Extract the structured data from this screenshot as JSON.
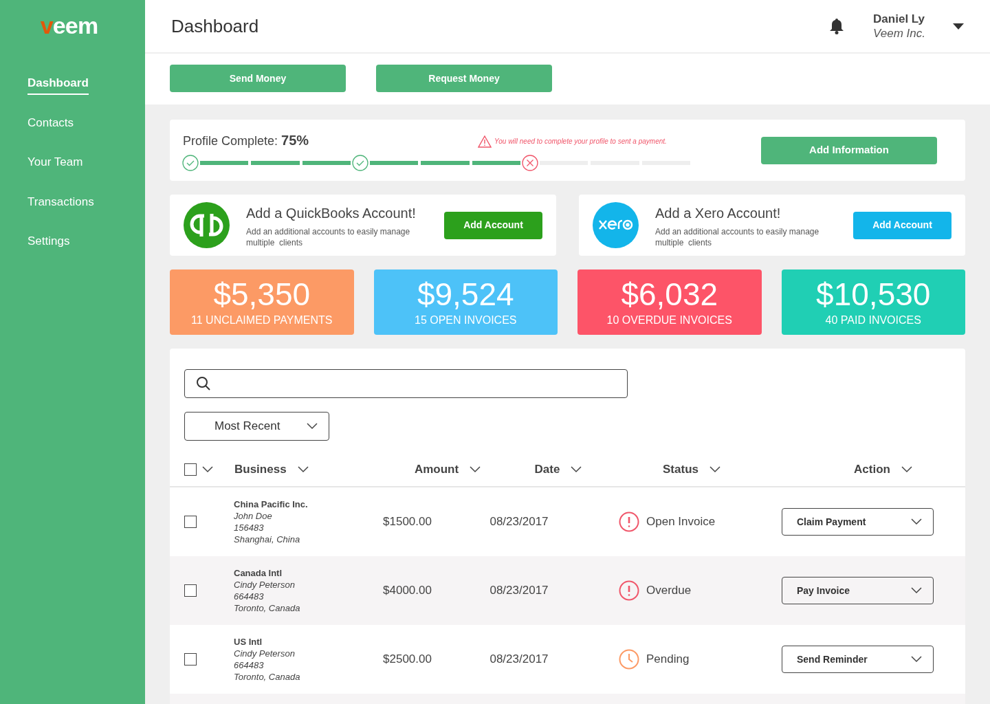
{
  "sidebar": {
    "logo": "veem",
    "items": [
      {
        "label": "Dashboard",
        "selected": true
      },
      {
        "label": "Contacts",
        "selected": false
      },
      {
        "label": "Your Team",
        "selected": false
      },
      {
        "label": "Transactions",
        "selected": false
      },
      {
        "label": "Settings",
        "selected": false
      }
    ]
  },
  "header": {
    "title": "Dashboard",
    "user_name": "Daniel Ly",
    "company": "Veem Inc."
  },
  "actions": [
    "Send Money",
    "Request Money"
  ],
  "profile": {
    "label": "Profile Complete:",
    "percent": "75%",
    "warning": "You will need to complete your profile to sent a payment.",
    "button": "Add Information",
    "steps": [
      {
        "kind": "done"
      },
      {
        "kind": "segment",
        "filled": true
      },
      {
        "kind": "segment",
        "filled": true
      },
      {
        "kind": "segment",
        "filled": true
      },
      {
        "kind": "done"
      },
      {
        "kind": "segment",
        "filled": true
      },
      {
        "kind": "segment",
        "filled": true
      },
      {
        "kind": "segment",
        "filled": true
      },
      {
        "kind": "error"
      },
      {
        "kind": "segment",
        "filled": false
      },
      {
        "kind": "segment",
        "filled": false
      },
      {
        "kind": "segment",
        "filled": false
      }
    ]
  },
  "integrations": [
    {
      "kind": "quickbooks",
      "title": "Add a QuickBooks Account!",
      "description": "Add an additional accounts to easily manage multiple  clients",
      "button": "Add Account",
      "color": "#2ca01c"
    },
    {
      "kind": "xero",
      "title": "Add a Xero Account!",
      "description": "Add an additional accounts to easily manage multiple  clients",
      "button": "Add Account",
      "color": "#13b5ea"
    }
  ],
  "stats": [
    {
      "amount": "$5,350",
      "label": "11 UNCLAIMED PAYMENTS",
      "color": "#fc9a65"
    },
    {
      "amount": "$9,524",
      "label": "15 OPEN INVOICES",
      "color": "#4dc2f8"
    },
    {
      "amount": "$6,032",
      "label": "10 OVERDUE INVOICES",
      "color": "#fd5468"
    },
    {
      "amount": "$10,530",
      "label": "40 PAID INVOICES",
      "color": "#20cfb4"
    }
  ],
  "filter": {
    "sort": "Most Recent"
  },
  "table": {
    "select_all_checked": false,
    "columns": [
      "Business",
      "Amount",
      "Date",
      "Status",
      "Action"
    ],
    "rows": [
      {
        "checked": false,
        "business": "China Pacific Inc.",
        "contact": "John Doe",
        "id": "156483",
        "location": "Shanghai, China",
        "amount": "$1500.00",
        "date": "08/23/2017",
        "status": "Open Invoice",
        "kind": "alert",
        "action": "Claim Payment"
      },
      {
        "checked": false,
        "business": "Canada Intl",
        "contact": "Cindy Peterson",
        "id": "664483",
        "location": "Toronto, Canada",
        "amount": "$4000.00",
        "date": "08/23/2017",
        "status": "Overdue",
        "kind": "alert",
        "action": "Pay Invoice"
      },
      {
        "checked": false,
        "business": "US Intl",
        "contact": "Cindy Peterson",
        "id": "664483",
        "location": "Toronto, Canada",
        "amount": "$2500.00",
        "date": "08/23/2017",
        "status": "Pending",
        "kind": "pending",
        "action": "Send Reminder"
      }
    ]
  }
}
